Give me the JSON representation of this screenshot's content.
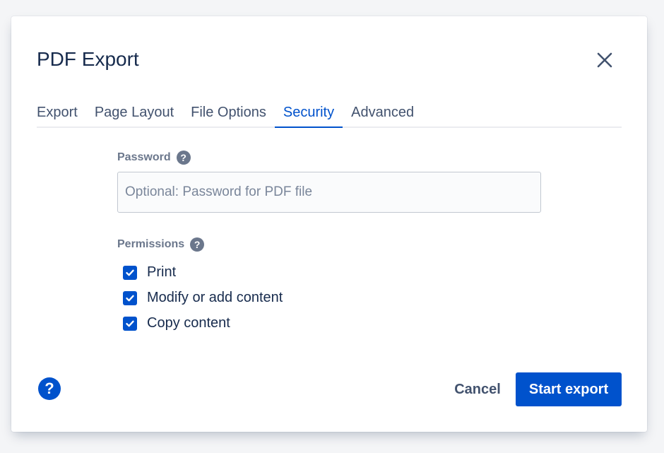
{
  "dialog": {
    "title": "PDF Export"
  },
  "tabs": [
    {
      "label": "Export",
      "active": false
    },
    {
      "label": "Page Layout",
      "active": false
    },
    {
      "label": "File Options",
      "active": false
    },
    {
      "label": "Security",
      "active": true
    },
    {
      "label": "Advanced",
      "active": false
    }
  ],
  "password": {
    "label": "Password",
    "value": "",
    "placeholder": "Optional: Password for PDF file"
  },
  "permissions": {
    "label": "Permissions",
    "options": [
      {
        "label": "Print",
        "checked": true
      },
      {
        "label": "Modify or add content",
        "checked": true
      },
      {
        "label": "Copy content",
        "checked": true
      }
    ]
  },
  "footer": {
    "cancel_label": "Cancel",
    "start_label": "Start export"
  },
  "icons": {
    "close": "close-icon",
    "help": "help-icon",
    "check": "check-icon"
  },
  "colors": {
    "accent": "#0052cc",
    "text": "#172b4d",
    "subtle": "#6b778c"
  }
}
